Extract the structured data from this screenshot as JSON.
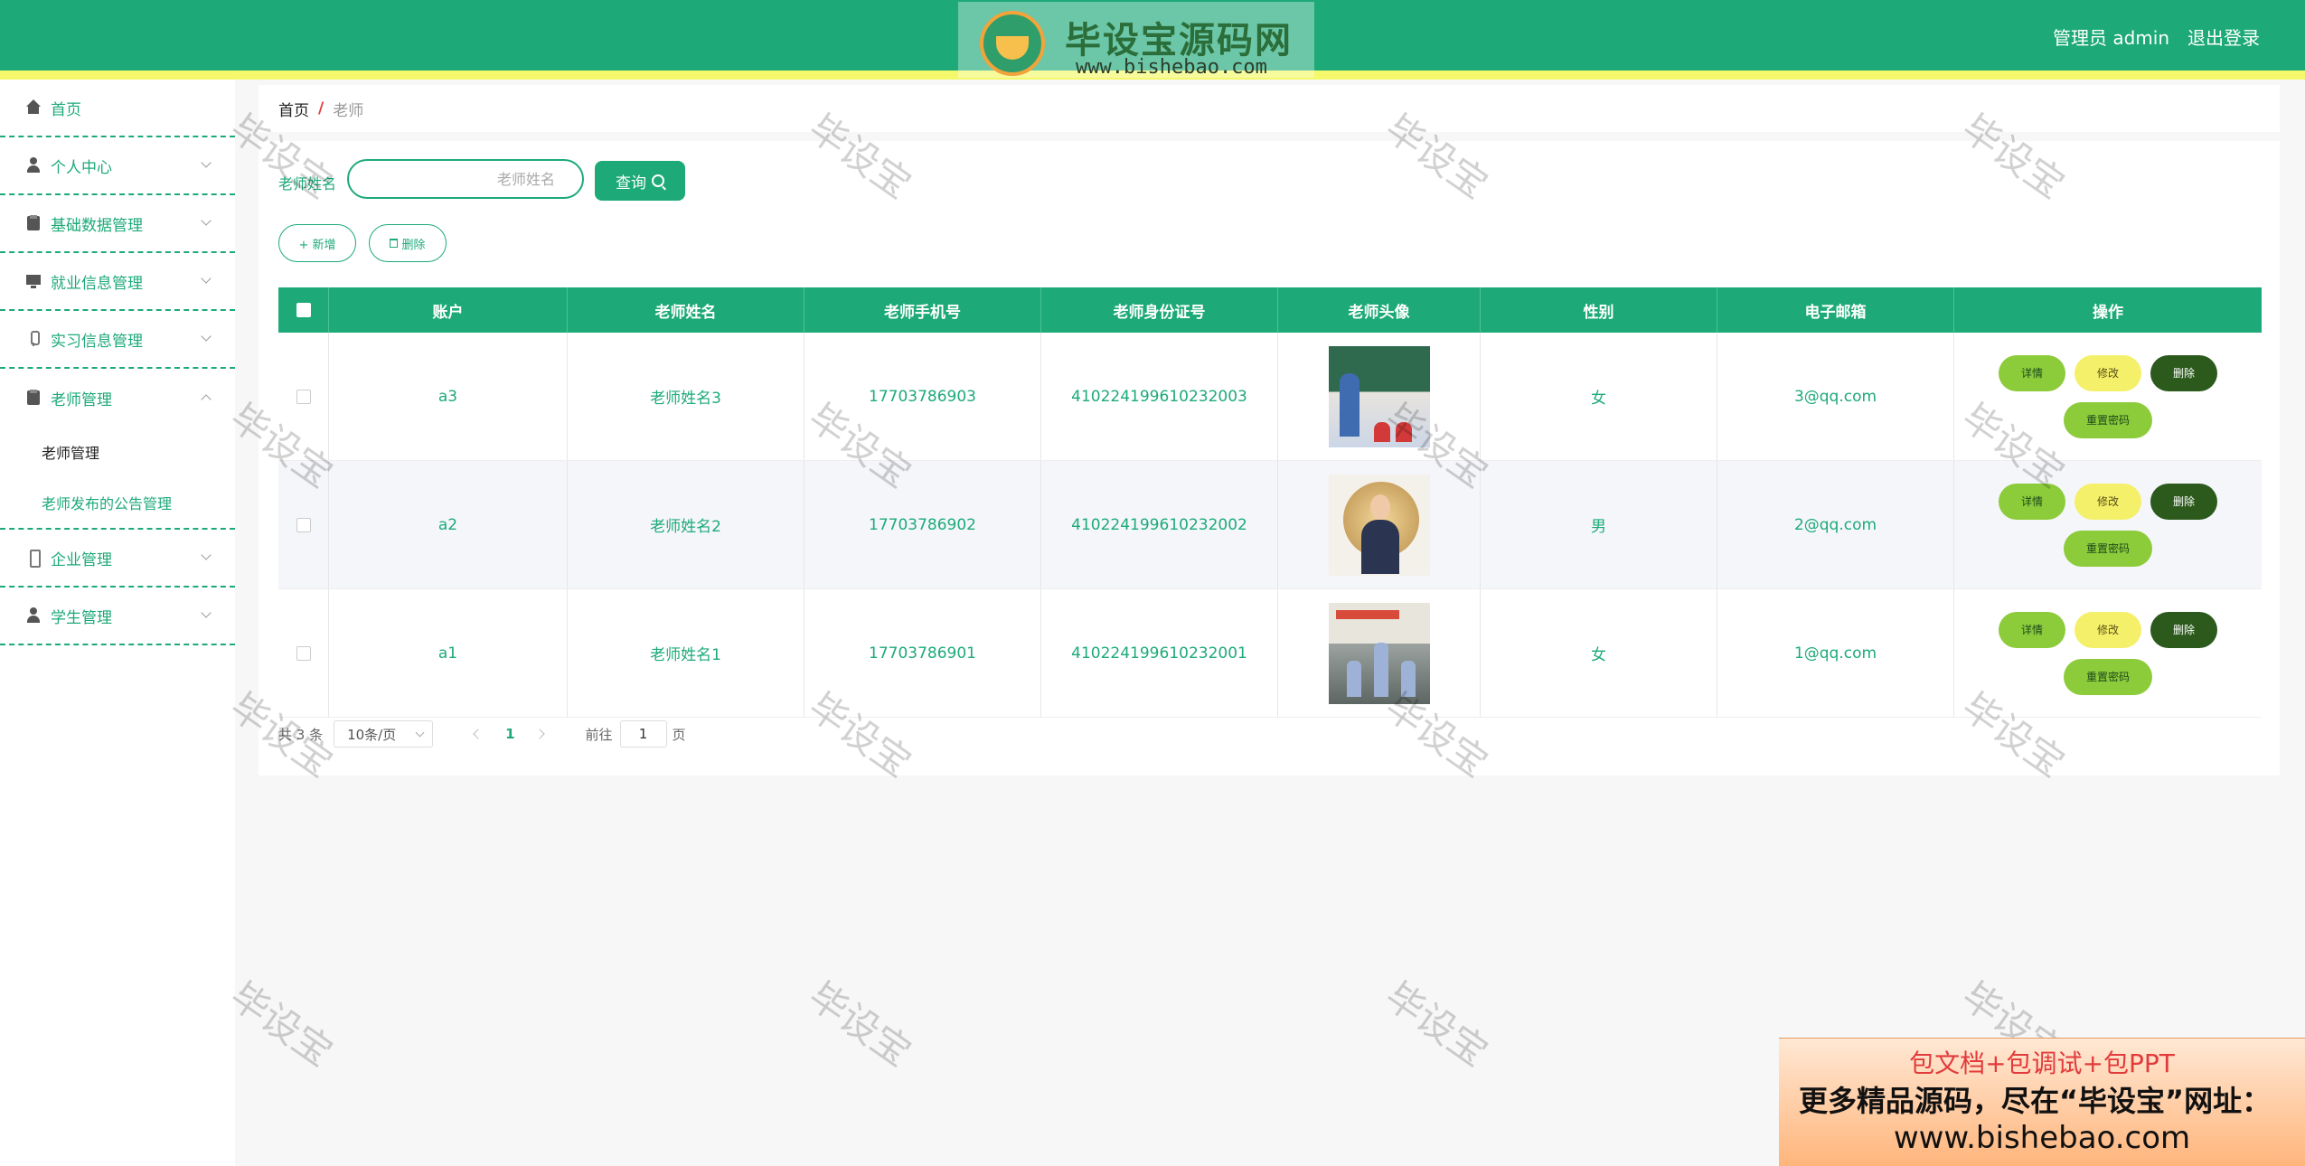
{
  "header": {
    "logo_title": "毕设宝源码网",
    "logo_url": "www.bishebao.com",
    "user_label": "管理员 admin",
    "logout_label": "退出登录"
  },
  "sidebar": {
    "items": [
      {
        "label": "首页",
        "icon": "home-icon"
      },
      {
        "label": "个人中心",
        "icon": "user-icon"
      },
      {
        "label": "基础数据管理",
        "icon": "clipboard-icon"
      },
      {
        "label": "就业信息管理",
        "icon": "monitor-icon"
      },
      {
        "label": "实习信息管理",
        "icon": "microphone-icon"
      },
      {
        "label": "老师管理",
        "icon": "clipboard-icon",
        "expanded": true,
        "children": [
          "老师管理",
          "老师发布的公告管理"
        ]
      },
      {
        "label": "企业管理",
        "icon": "phone-icon"
      },
      {
        "label": "学生管理",
        "icon": "user-icon"
      }
    ]
  },
  "breadcrumb": {
    "home": "首页",
    "separator": "/",
    "current": "老师"
  },
  "search": {
    "label": "老师姓名",
    "placeholder": "老师姓名",
    "query_label": "查询"
  },
  "actions": {
    "add_label": "+ 新增",
    "delete_label": "删除"
  },
  "table": {
    "headers": [
      "账户",
      "老师姓名",
      "老师手机号",
      "老师身份证号",
      "老师头像",
      "性别",
      "电子邮箱",
      "操作"
    ],
    "rows": [
      {
        "account": "a3",
        "name": "老师姓名3",
        "phone": "17703786903",
        "id_card": "410224199610232003",
        "avatar": "classroom-photo",
        "gender": "女",
        "email": "3@qq.com"
      },
      {
        "account": "a2",
        "name": "老师姓名2",
        "phone": "17703786902",
        "id_card": "410224199610232002",
        "avatar": "teacher-illustration",
        "gender": "男",
        "email": "2@qq.com"
      },
      {
        "account": "a1",
        "name": "老师姓名1",
        "phone": "17703786901",
        "id_card": "410224199610232001",
        "avatar": "classroom-photo",
        "gender": "女",
        "email": "1@qq.com"
      }
    ],
    "op_labels": {
      "detail": "详情",
      "edit": "修改",
      "delete": "删除",
      "reset": "重置密码"
    }
  },
  "pagination": {
    "total_label": "共 3 条",
    "page_size": "10条/页",
    "current_page": "1",
    "goto_prefix": "前往",
    "goto_value": "1",
    "goto_suffix": "页"
  },
  "watermark_text": "毕设宝",
  "ad": {
    "line1": "包文档+包调试+包PPT",
    "line2": "更多精品源码，尽在“毕设宝”网址：",
    "line3": "www.bishebao.com"
  },
  "colors": {
    "primary": "#1daa78",
    "accent_yellow": "#f4f86a",
    "danger": "#2b5a1c"
  }
}
